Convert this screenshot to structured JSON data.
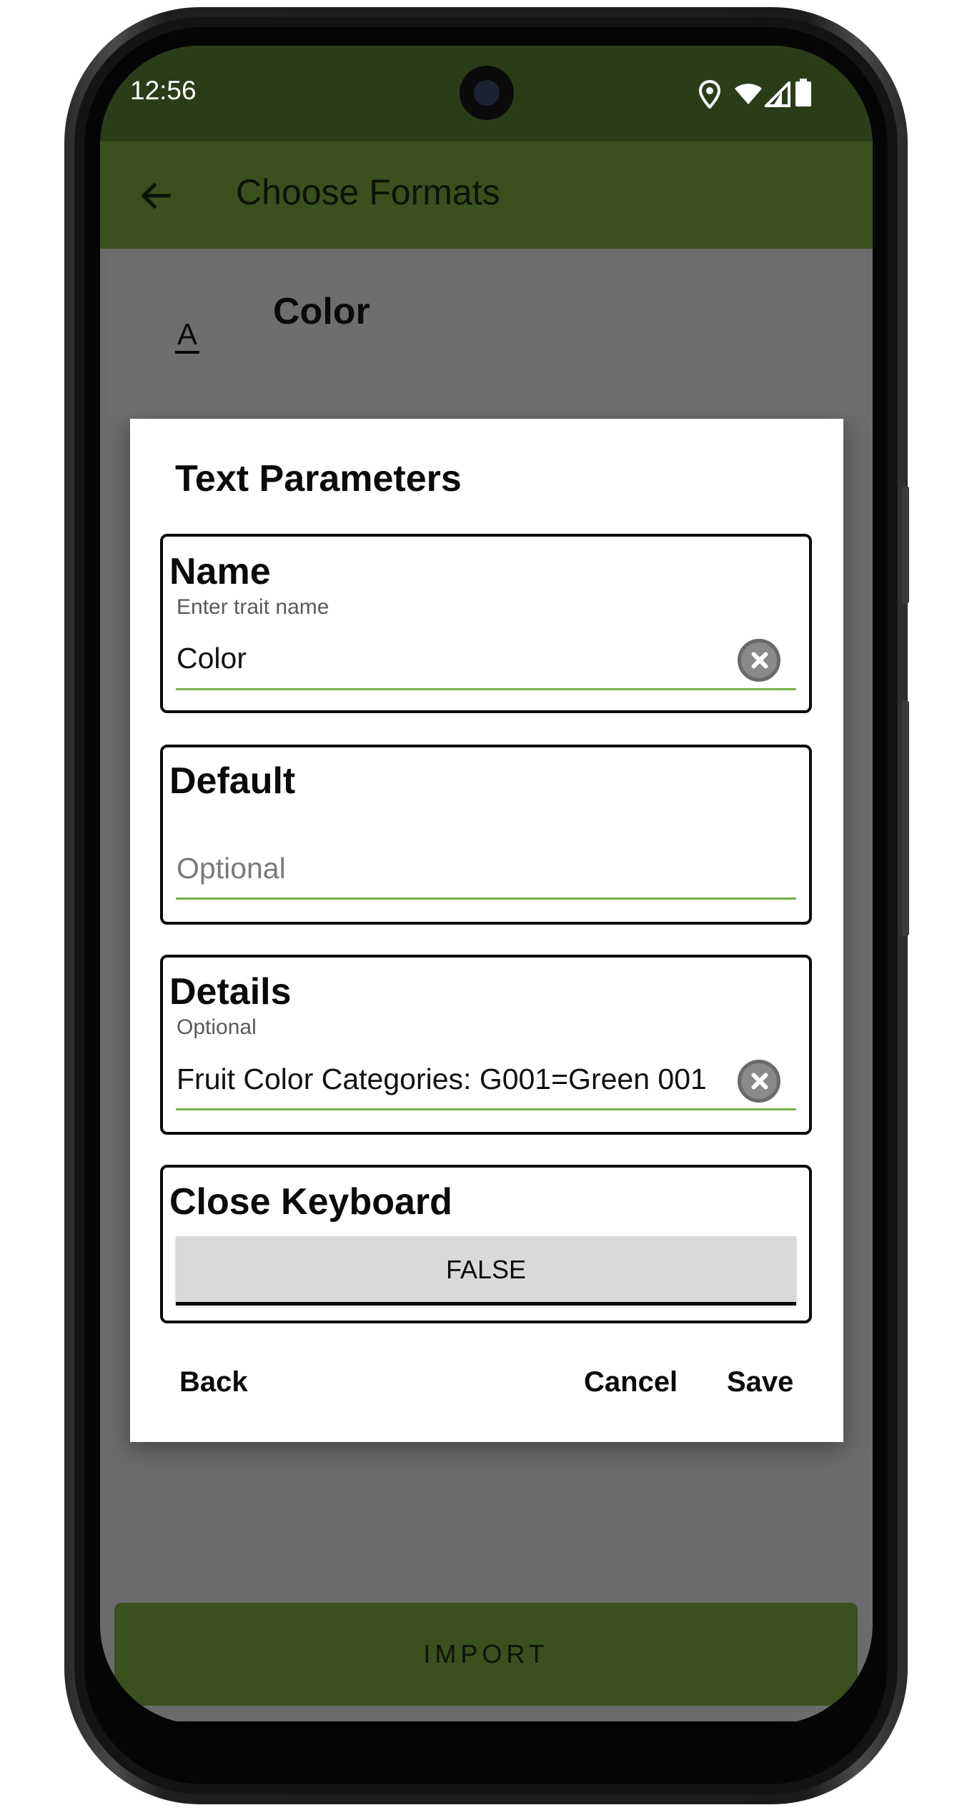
{
  "status_bar": {
    "time": "12:56"
  },
  "app_bar": {
    "title": "Choose Formats"
  },
  "trait_row": {
    "icon_glyph": "A",
    "title": "Color"
  },
  "dialog": {
    "title": "Text Parameters",
    "name": {
      "label": "Name",
      "helper": "Enter trait name",
      "value": "Color"
    },
    "default": {
      "label": "Default",
      "placeholder": "Optional"
    },
    "details": {
      "label": "Details",
      "helper": "Optional",
      "value": "Fruit Color Categories: G001=Green 001"
    },
    "close_keyboard": {
      "label": "Close Keyboard",
      "toggle_value": "FALSE"
    },
    "actions": {
      "back": "Back",
      "cancel": "Cancel",
      "save": "Save"
    }
  },
  "import_button": {
    "label": "IMPORT"
  },
  "colors": {
    "status_bar": "#2b3d18",
    "app_bar": "#3a501f",
    "underline": "#7ab04a"
  }
}
